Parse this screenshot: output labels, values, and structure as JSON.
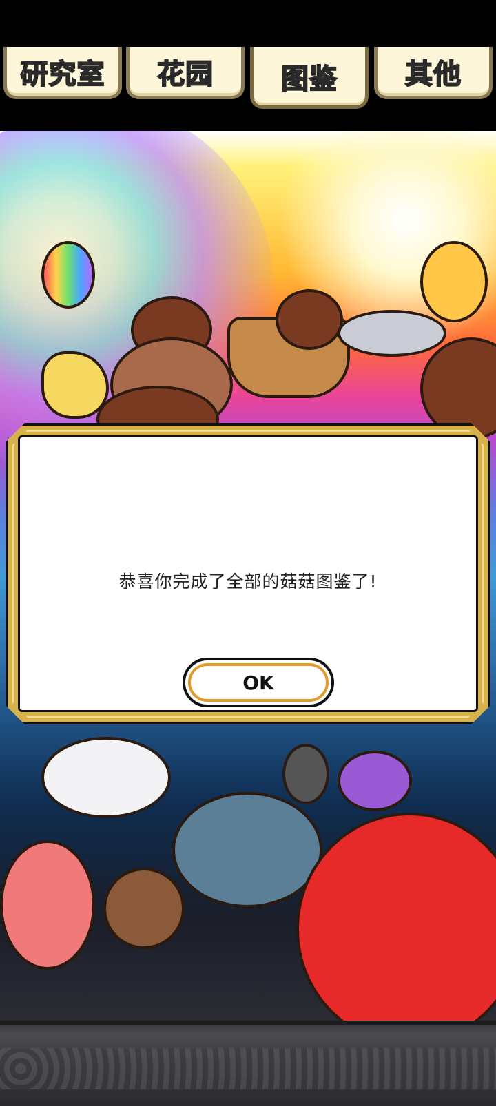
{
  "tabs": [
    {
      "label": "研究室",
      "active": false
    },
    {
      "label": "花园",
      "active": false
    },
    {
      "label": "图鉴",
      "active": true
    },
    {
      "label": "其他",
      "active": false
    }
  ],
  "dialog": {
    "message": "恭喜你完成了全部的菇菇图鉴了!",
    "ok_label": "OK"
  },
  "colors": {
    "tab_background": "#fdf6d8",
    "active_tab_text": "#ffe23a",
    "inactive_tab_text": "#6b6b6b",
    "dialog_border_gold": "#d7b24a",
    "ok_button_accent": "#e39a2a"
  }
}
